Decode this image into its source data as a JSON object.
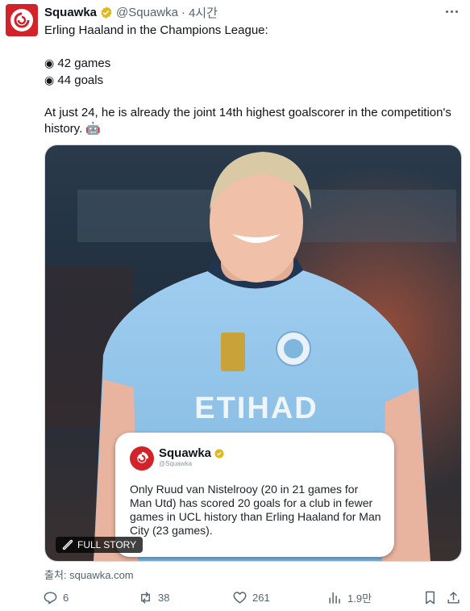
{
  "author": {
    "display_name": "Squawka",
    "handle": "@Squawka",
    "separator": "·",
    "time": "4시간"
  },
  "tweet": {
    "line1": "Erling Haaland in the Champions League:",
    "bullet_char": "◉",
    "stat1": "42 games",
    "stat2": "44 goals",
    "line3": "At just 24, he is already the joint 14th highest goalscorer in the competition's history.",
    "emoji": "🤖"
  },
  "media": {
    "quote_card": {
      "name": "Squawka",
      "handle": "@Squawka",
      "text": "Only Ruud van Nistelrooy (20 in 21 games for Man Utd) has scored 20 goals for a club in fewer games in UCL history than Erling Haaland for Man City (23 games)."
    },
    "jersey_sponsor": "ETIHAD",
    "badge_label": "FULL STORY"
  },
  "source": "출처: squawka.com",
  "actions": {
    "replies": "6",
    "reposts": "38",
    "likes": "261",
    "views": "1.9만"
  },
  "colors": {
    "brand_red": "#d3232a",
    "verified_gold": "#e2b719",
    "muted_text": "#536471",
    "jersey_blue": "#8fc1e6"
  }
}
